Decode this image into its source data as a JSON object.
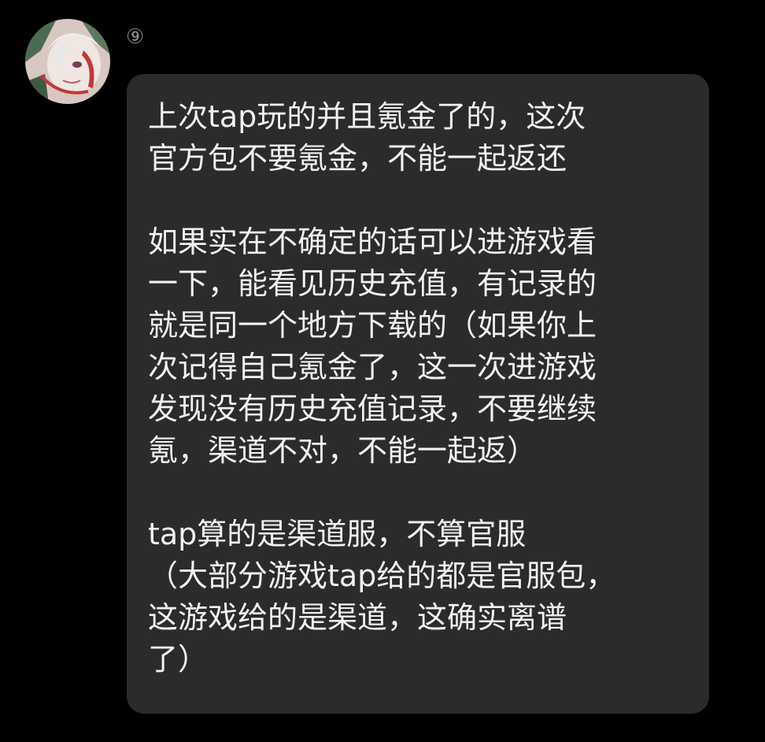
{
  "message": {
    "sender_label": "⑨",
    "paragraphs": [
      "上次tap玩的并且氪金了的，这次\n官方包不要氪金，不能一起返还",
      "如果实在不确定的话可以进游戏看\n一下，能看见历史充值，有记录的\n就是同一个地方下载的（如果你上\n次记得自己氪金了，这一次进游戏\n发现没有历史充值记录，不要继续\n氪，渠道不对，不能一起返）",
      "tap算的是渠道服，不算官服\n（大部分游戏tap给的都是官服包，\n这游戏给的是渠道，这确实离谱\n了）"
    ]
  },
  "avatar": {
    "icon": "user-avatar-icon",
    "colors": {
      "background": "#d9c7c2",
      "hair": "#eeeeee",
      "accent": "#c0393b",
      "foliage": "#4d6b52"
    }
  },
  "theme": {
    "page_background": "#000000",
    "bubble_background": "#2b2b2b",
    "text_color": "#f2f2f2",
    "sender_color": "#8a8a8a"
  }
}
